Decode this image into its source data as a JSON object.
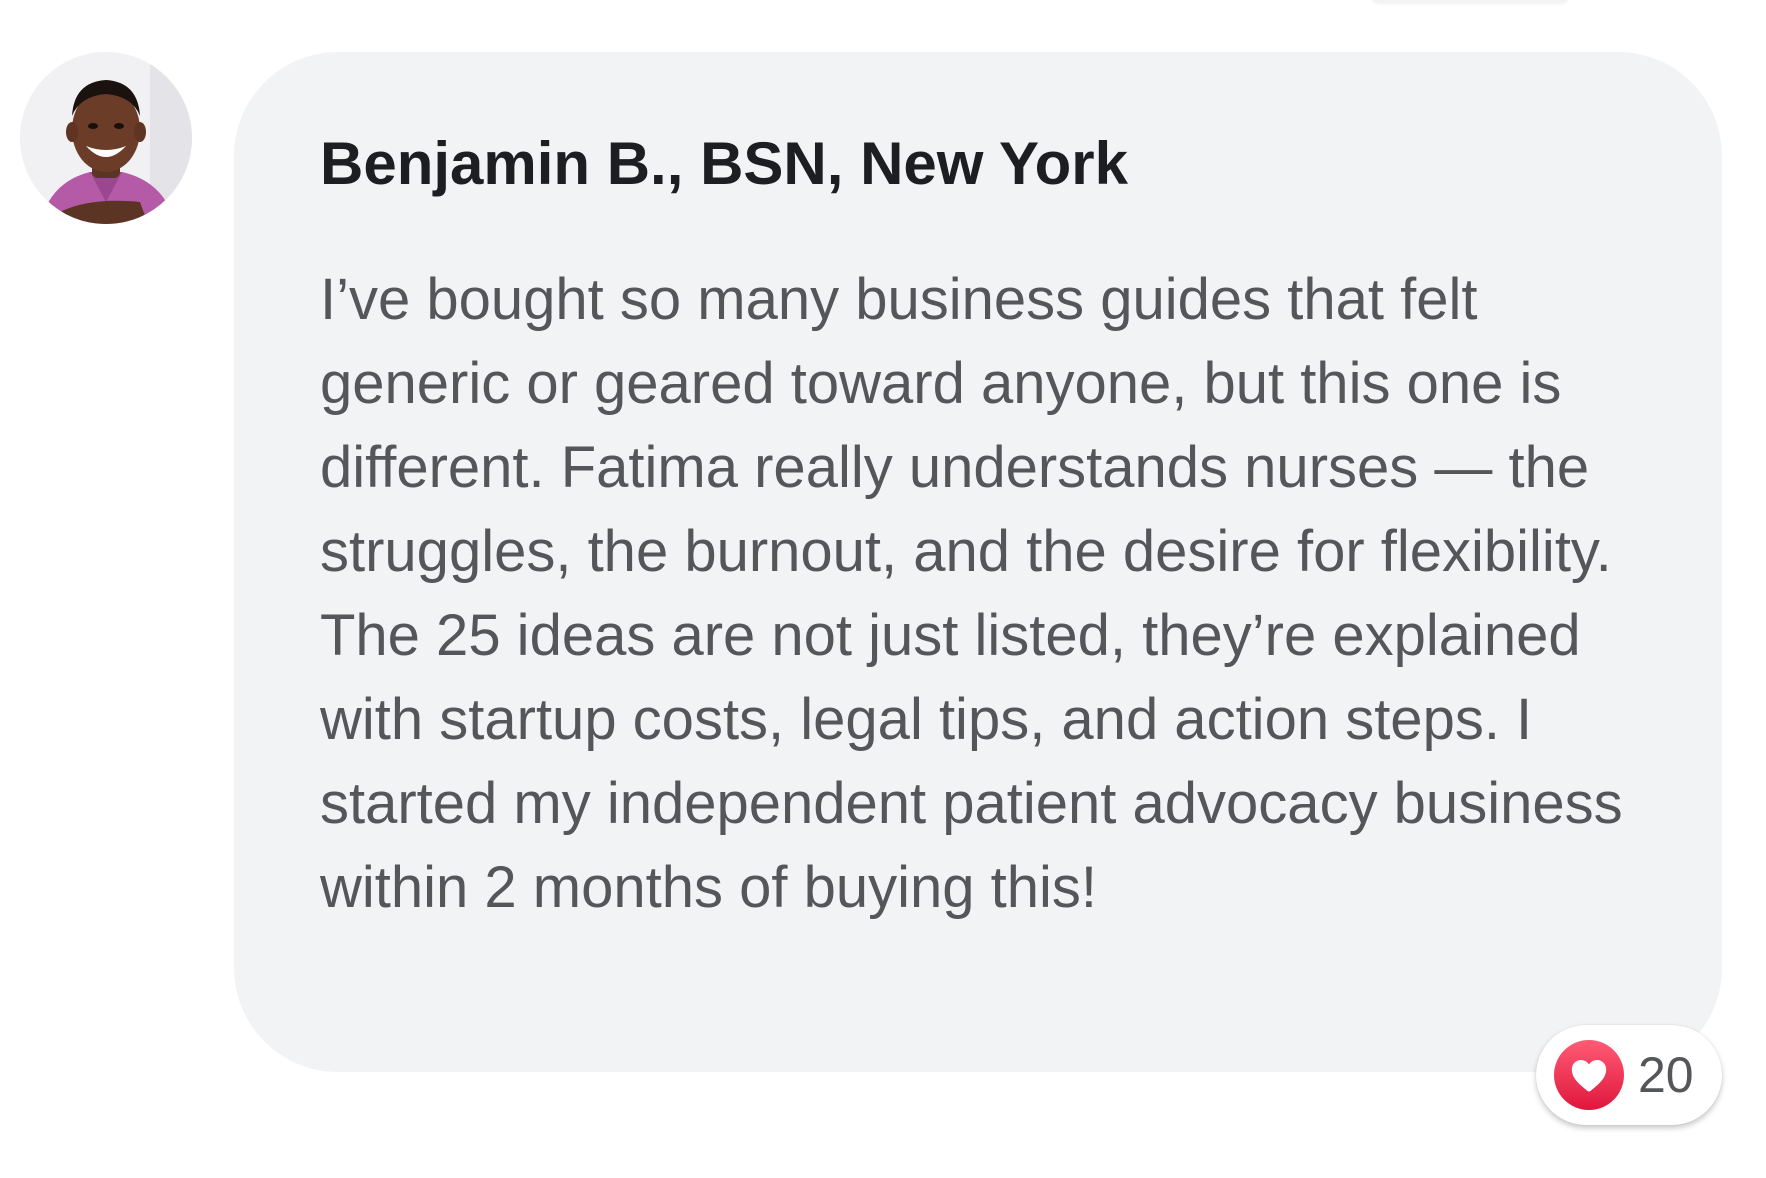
{
  "comment": {
    "author": "Benjamin B., BSN, New York",
    "text": "I’ve bought so many business guides that felt generic or geared toward anyone, but this one is different. Fatima really understands nurses — the struggles, the burnout, and the desire for flexibility. The 25 ideas are not just listed, they’re explained with startup costs, legal tips, and action steps. I started my independent patient advocacy business within 2 months of buying this!",
    "reaction": {
      "icon": "heart-icon",
      "count": "20",
      "color": "#f33e58"
    }
  }
}
